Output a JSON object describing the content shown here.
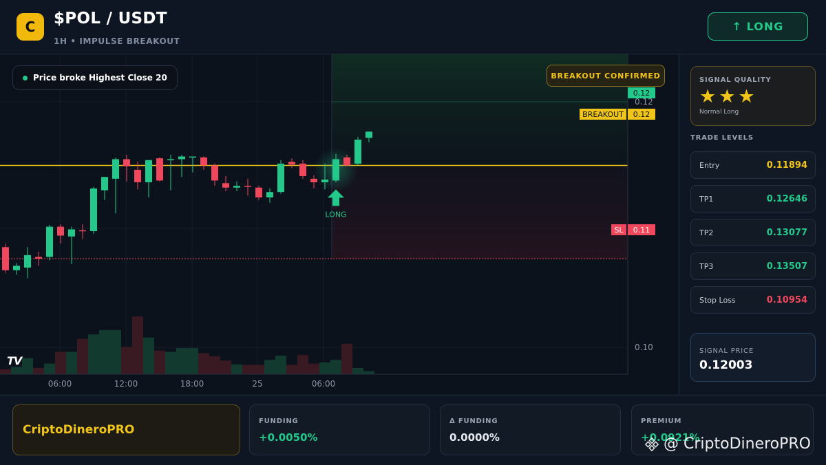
{
  "header": {
    "logo_letter": "C",
    "pair": "$POL / USDT",
    "subtitle": "1H • IMPULSE BREAKOUT",
    "long_button": "↑ LONG"
  },
  "chart": {
    "legend_text": "Price broke Highest Close 20",
    "breakout_badge": "BREAKOUT CONFIRMED",
    "long_marker_label": "LONG",
    "tv_logo": "TV",
    "price_tags": {
      "last_price": "0.12",
      "breakout_label": "BREAKOUT",
      "breakout_price": "0.12",
      "sl_label": "SL",
      "sl_price": "0.11"
    },
    "colors": {
      "up": "#22c98a",
      "down": "#f0475c",
      "breakout_line": "#f0c419",
      "sl_line": "#f0475c",
      "up_volume": "#123a2e",
      "down_volume": "#3a1a22"
    }
  },
  "chart_data": {
    "type": "candlestick",
    "x_tick_labels": [
      "06:00",
      "12:00",
      "18:00",
      "25",
      "06:00"
    ],
    "y_tick_labels": [
      "0.12",
      "0.11",
      "0.10"
    ],
    "y_range": [
      0.0965,
      0.1325
    ],
    "breakout_level": 0.12,
    "stop_loss_level": 0.1095,
    "candles": [
      {
        "o": 0.1108,
        "h": 0.1112,
        "l": 0.1079,
        "c": 0.1082
      },
      {
        "o": 0.1082,
        "h": 0.109,
        "l": 0.1077,
        "c": 0.1087
      },
      {
        "o": 0.1085,
        "h": 0.1108,
        "l": 0.1073,
        "c": 0.1099
      },
      {
        "o": 0.1097,
        "h": 0.1103,
        "l": 0.1087,
        "c": 0.1095
      },
      {
        "o": 0.1097,
        "h": 0.1133,
        "l": 0.1093,
        "c": 0.1131
      },
      {
        "o": 0.1131,
        "h": 0.1134,
        "l": 0.1112,
        "c": 0.1121
      },
      {
        "o": 0.112,
        "h": 0.1131,
        "l": 0.1089,
        "c": 0.1128
      },
      {
        "o": 0.1127,
        "h": 0.1134,
        "l": 0.1117,
        "c": 0.1126
      },
      {
        "o": 0.1126,
        "h": 0.1176,
        "l": 0.1123,
        "c": 0.1174
      },
      {
        "o": 0.1172,
        "h": 0.1187,
        "l": 0.1161,
        "c": 0.1187
      },
      {
        "o": 0.1185,
        "h": 0.1209,
        "l": 0.1146,
        "c": 0.1207
      },
      {
        "o": 0.1207,
        "h": 0.1212,
        "l": 0.1182,
        "c": 0.1199
      },
      {
        "o": 0.1195,
        "h": 0.1204,
        "l": 0.1173,
        "c": 0.1181
      },
      {
        "o": 0.1181,
        "h": 0.1201,
        "l": 0.1164,
        "c": 0.1206
      },
      {
        "o": 0.1208,
        "h": 0.1209,
        "l": 0.1182,
        "c": 0.1183
      },
      {
        "o": 0.1207,
        "h": 0.1212,
        "l": 0.1172,
        "c": 0.1207
      },
      {
        "o": 0.1207,
        "h": 0.1212,
        "l": 0.1187,
        "c": 0.121
      },
      {
        "o": 0.1209,
        "h": 0.121,
        "l": 0.1192,
        "c": 0.121
      },
      {
        "o": 0.1209,
        "h": 0.121,
        "l": 0.1195,
        "c": 0.12
      },
      {
        "o": 0.12,
        "h": 0.1202,
        "l": 0.1177,
        "c": 0.1183
      },
      {
        "o": 0.118,
        "h": 0.1188,
        "l": 0.1171,
        "c": 0.1175
      },
      {
        "o": 0.1175,
        "h": 0.1182,
        "l": 0.1171,
        "c": 0.1177
      },
      {
        "o": 0.1177,
        "h": 0.1185,
        "l": 0.1166,
        "c": 0.1176
      },
      {
        "o": 0.1175,
        "h": 0.1177,
        "l": 0.1161,
        "c": 0.1164
      },
      {
        "o": 0.1164,
        "h": 0.1174,
        "l": 0.1158,
        "c": 0.117
      },
      {
        "o": 0.117,
        "h": 0.1206,
        "l": 0.1168,
        "c": 0.1202
      },
      {
        "o": 0.1204,
        "h": 0.1208,
        "l": 0.1197,
        "c": 0.1201
      },
      {
        "o": 0.1202,
        "h": 0.1206,
        "l": 0.1185,
        "c": 0.1188
      },
      {
        "o": 0.1185,
        "h": 0.1189,
        "l": 0.1174,
        "c": 0.1181
      },
      {
        "o": 0.1181,
        "h": 0.1202,
        "l": 0.1173,
        "c": 0.1184
      },
      {
        "o": 0.1183,
        "h": 0.1213,
        "l": 0.1181,
        "c": 0.1207
      },
      {
        "o": 0.1209,
        "h": 0.1212,
        "l": 0.1199,
        "c": 0.12
      },
      {
        "o": 0.1202,
        "h": 0.1232,
        "l": 0.12,
        "c": 0.1229
      },
      {
        "o": 0.1231,
        "h": 0.1238,
        "l": 0.1226,
        "c": 0.1238
      }
    ],
    "volume": [
      0.8,
      1.2,
      2.6,
      1.0,
      1.7,
      3.6,
      3.6,
      5.7,
      6.4,
      7.1,
      7.1,
      4.4,
      9.3,
      5.9,
      3.8,
      3.6,
      4.2,
      4.2,
      3.4,
      2.9,
      2.2,
      1.6,
      1.5,
      1.5,
      2.3,
      3.0,
      1.5,
      3.1,
      1.7,
      1.9,
      2.3,
      4.9,
      1.0,
      0.5
    ],
    "signal_index": 30
  },
  "sidebar": {
    "quality_title": "SIGNAL QUALITY",
    "stars": "★★★",
    "quality_note": "Normal Long",
    "levels_title": "TRADE LEVELS",
    "levels": [
      {
        "label": "Entry",
        "value": "0.11894",
        "color": "#f0c419"
      },
      {
        "label": "TP1",
        "value": "0.12646",
        "color": "#22c98a"
      },
      {
        "label": "TP2",
        "value": "0.13077",
        "color": "#22c98a"
      },
      {
        "label": "TP3",
        "value": "0.13507",
        "color": "#22c98a"
      },
      {
        "label": "Stop Loss",
        "value": "0.10954",
        "color": "#f0475c"
      }
    ],
    "signal_price_label": "SIGNAL PRICE",
    "signal_price_value": "0.12003"
  },
  "footer": {
    "brand": "CriptoDineroPRO",
    "stats": [
      {
        "label": "FUNDING",
        "value": "+0.0050%",
        "color": "#22c98a"
      },
      {
        "label": "Δ FUNDING",
        "value": "0.0000%",
        "color": "#e6e9ef"
      },
      {
        "label": "PREMIUM",
        "value": "+0.0921%",
        "color": "#22c98a"
      }
    ],
    "watermark": "@ CriptoDineroPRO"
  }
}
